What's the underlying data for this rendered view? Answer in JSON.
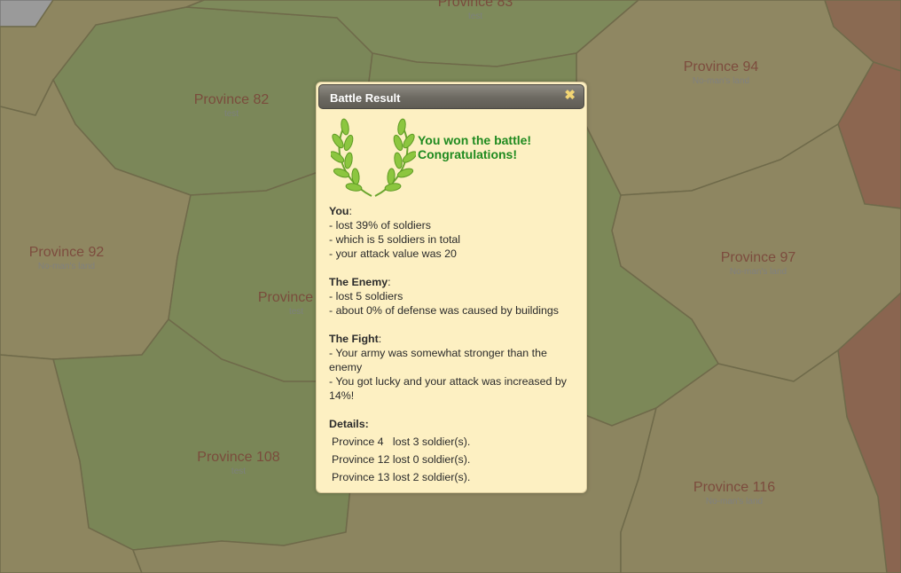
{
  "map": {
    "provinces": [
      {
        "name": "Province 83",
        "owner": "test"
      },
      {
        "name": "Province 82",
        "owner": "test"
      },
      {
        "name": "Province 94",
        "owner": "No-man's land"
      },
      {
        "name": "Province 92",
        "owner": "No-man's land"
      },
      {
        "name": "Province",
        "owner": "test"
      },
      {
        "name": "Province 97",
        "owner": "No-man's land"
      },
      {
        "name": "Province 108",
        "owner": "test"
      },
      {
        "name": "Province 116",
        "owner": "No-man's land"
      }
    ]
  },
  "dialog": {
    "title": "Battle Result",
    "close_icon": "close-x-icon",
    "win_line1": "You won the battle!",
    "win_line2": "Congratulations!",
    "you": {
      "header": "You",
      "lines": [
        "- lost 39% of soldiers",
        "- which is 5 soldiers in total",
        "- your attack value was 20"
      ]
    },
    "enemy": {
      "header": "The Enemy",
      "lines": [
        "- lost 5 soldiers",
        "- about 0% of defense was caused by buildings"
      ]
    },
    "fight": {
      "header": "The Fight",
      "lines": [
        "- Your army was somewhat stronger than the enemy",
        "- You got lucky and your attack was increased by 14%!"
      ]
    },
    "details": {
      "header": "Details:",
      "rows": [
        "Province 4   lost 3 soldier(s).",
        "Province 12 lost 0 soldier(s).",
        "Province 13 lost 2 soldier(s)."
      ]
    }
  },
  "colors": {
    "green_province": "#7d8a5c",
    "brown_province": "#8e855f",
    "red_province": "#8b6650",
    "win_text": "#1f8a1f"
  }
}
